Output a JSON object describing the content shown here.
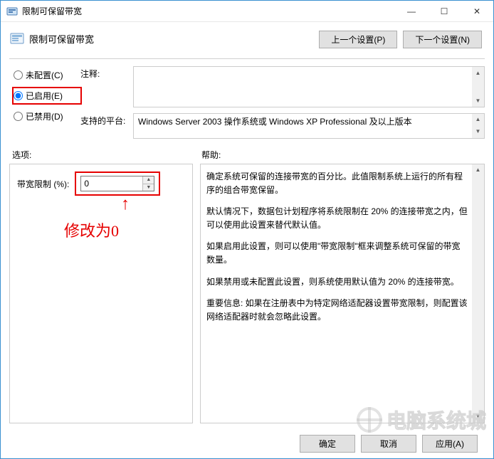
{
  "window": {
    "title": "限制可保留带宽",
    "minimize_glyph": "—",
    "maximize_glyph": "☐",
    "close_glyph": "✕"
  },
  "header": {
    "title": "限制可保留带宽",
    "prev_btn": "上一个设置(P)",
    "next_btn": "下一个设置(N)"
  },
  "radios": {
    "not_configured": "未配置(C)",
    "enabled": "已启用(E)",
    "disabled": "已禁用(D)",
    "selected": "enabled"
  },
  "fields": {
    "comment_label": "注释:",
    "comment_value": "",
    "platform_label": "支持的平台:",
    "platform_value": "Windows Server 2003 操作系统或 Windows XP Professional 及以上版本"
  },
  "mid": {
    "options_label": "选项:",
    "help_label": "帮助:"
  },
  "options": {
    "bandwidth_label": "带宽限制 (%):",
    "bandwidth_value": "0"
  },
  "annotation": {
    "arrow": "↑",
    "text": "修改为0"
  },
  "help": {
    "p1": "确定系统可保留的连接带宽的百分比。此值限制系统上运行的所有程序的组合带宽保留。",
    "p2": "默认情况下，数据包计划程序将系统限制在 20% 的连接带宽之内，但可以使用此设置来替代默认值。",
    "p3": "如果启用此设置，则可以使用\"带宽限制\"框来调整系统可保留的带宽数量。",
    "p4": "如果禁用或未配置此设置，则系统使用默认值为 20% 的连接带宽。",
    "p5": "重要信息: 如果在注册表中为特定网络适配器设置带宽限制，则配置该网络适配器时就会忽略此设置。"
  },
  "footer": {
    "ok": "确定",
    "cancel": "取消",
    "apply": "应用(A)"
  },
  "watermark": "电脑系统城"
}
